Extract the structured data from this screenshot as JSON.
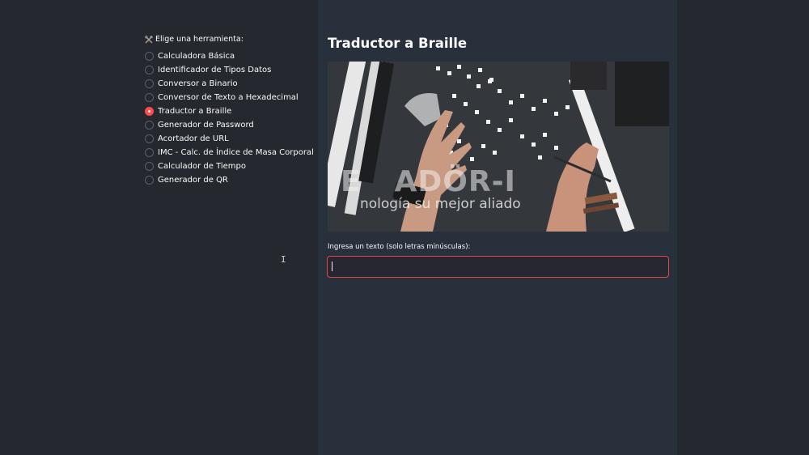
{
  "sidebar": {
    "radio_label": "Elige una herramienta:",
    "label_icon": "hammer-and-wrench-icon",
    "options": [
      {
        "label": "Calculadora Básica",
        "selected": false
      },
      {
        "label": "Identificador de Tipos Datos",
        "selected": false
      },
      {
        "label": "Conversor a Binario",
        "selected": false
      },
      {
        "label": "Conversor de Texto a Hexadecimal",
        "selected": false
      },
      {
        "label": "Traductor a Braille",
        "selected": true
      },
      {
        "label": "Generador de Password",
        "selected": false
      },
      {
        "label": "Acortador de URL",
        "selected": false
      },
      {
        "label": "IMC - Calc. de Índice de Masa Corporal",
        "selected": false
      },
      {
        "label": "Calculador de Tiempo",
        "selected": false
      },
      {
        "label": "Generador de QR",
        "selected": false
      }
    ]
  },
  "main": {
    "title": "Traductor a Braille",
    "hero": {
      "brand_text": "E     ADÖR-I",
      "tagline": "nología su mejor aliado"
    },
    "input": {
      "label": "Ingresa un texto (solo letras minúsculas):",
      "value": "",
      "placeholder": ""
    }
  },
  "colors": {
    "accent": "#ff4b4b",
    "main_bg": "#28303b",
    "sidebar_bg": "#25282e"
  }
}
